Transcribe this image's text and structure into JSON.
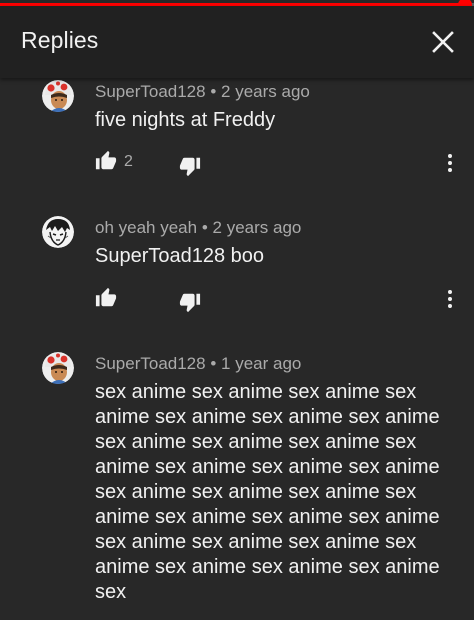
{
  "colors": {
    "background": "#282828",
    "header_background": "#212121",
    "primary_text": "#f1f1f1",
    "secondary_text": "#aaaaaa",
    "progress_accent": "#ff0000"
  },
  "video_progress": {
    "fraction": 0.98
  },
  "header": {
    "title": "Replies",
    "close_icon": "close-icon"
  },
  "comments": [
    {
      "author": "SuperToad128",
      "separator": "•",
      "age": "2 years ago",
      "text": "five nights at Freddy",
      "likes": "2",
      "avatar_icon": "toad-avatar"
    },
    {
      "author": "oh yeah yeah",
      "separator": "•",
      "age": "2 years ago",
      "text": "SuperToad128 boo",
      "likes": "",
      "avatar_icon": "manga-avatar"
    },
    {
      "author": "SuperToad128",
      "separator": "•",
      "age": "1 year ago",
      "text": "sex anime sex anime sex anime sex anime sex anime sex anime sex anime sex anime sex anime sex anime sex anime sex anime sex anime sex anime sex anime sex anime sex anime sex anime sex anime sex anime sex anime sex anime sex anime sex anime sex anime sex anime sex anime sex anime sex",
      "likes": "",
      "avatar_icon": "toad-avatar"
    }
  ]
}
